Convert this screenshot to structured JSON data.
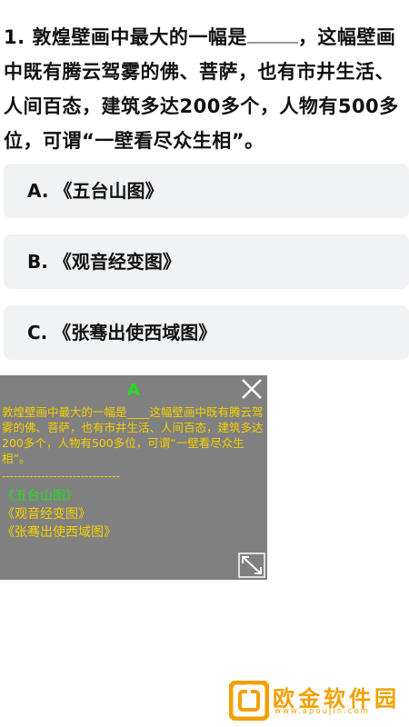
{
  "question": {
    "number": "1.",
    "text_before": "敦煌壁画中最大的一幅是",
    "text_after": "，这幅壁画中既有腾云驾雾的佛、菩萨，也有市井生活、人间百态，建筑多达200多个，人物有500多位，可谓“一壁看尽众生相”。"
  },
  "options": [
    {
      "letter": "A.",
      "text": "《五台山图》"
    },
    {
      "letter": "B.",
      "text": "《观音经变图》"
    },
    {
      "letter": "C.",
      "text": "《张骞出使西域图》"
    }
  ],
  "overlay": {
    "answer": "A",
    "question_text": "敦煌壁画中最大的一幅是____这幅壁画中既有腾云驾雾的佛、菩萨，也有市井生活、人间百态，建筑多达200多个，人物有500多位，可谓“一壁看尽众生相”。",
    "separator": "------------------------------",
    "options": [
      "《五台山图》",
      "《观音经变图》",
      "《张骞出使西域图》"
    ],
    "highlight_color": "#22dd22",
    "text_color": "#f4d000"
  },
  "watermark": {
    "name": "欧金软件园",
    "url": "www.apoujin.com",
    "color": "#f2a000"
  }
}
